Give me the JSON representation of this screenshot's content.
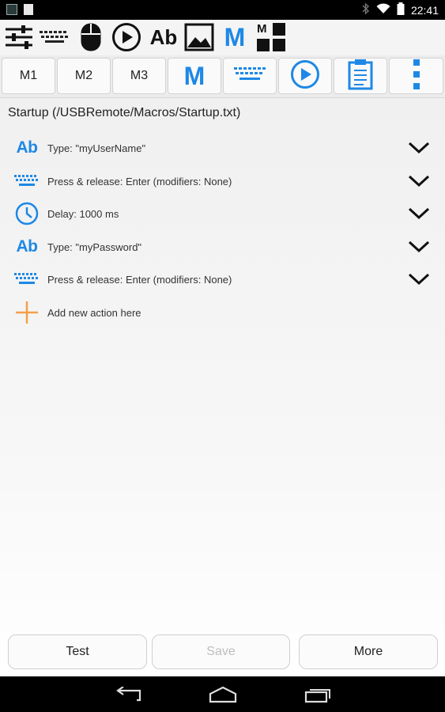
{
  "status_bar": {
    "time": "22:41",
    "icons": [
      "app-notification-icon",
      "sd-card-icon",
      "bluetooth-icon",
      "wifi-icon",
      "battery-icon"
    ]
  },
  "tool_strip": {
    "items": [
      "sliders-icon",
      "keyboard-icon",
      "mouse-icon",
      "play-icon",
      "text-ab-icon",
      "image-icon",
      "macro-m-icon",
      "macro-grid-icon"
    ],
    "ab_text": "Ab",
    "m_text": "M",
    "mini_m_text": "M"
  },
  "toolbar": {
    "m1": "M1",
    "m2": "M2",
    "m3": "M3",
    "m_text": "M",
    "icons": [
      "macro-m-icon",
      "keyboard-icon",
      "play-icon",
      "clipboard-icon",
      "overflow-menu-icon"
    ]
  },
  "macro": {
    "title": "Startup (/USBRemote/Macros/Startup.txt)",
    "actions": [
      {
        "icon": "text-ab-icon",
        "icon_text": "Ab",
        "label": "Type: \"myUserName\""
      },
      {
        "icon": "keyboard-icon",
        "label": "Press & release: Enter (modifiers: None)"
      },
      {
        "icon": "clock-icon",
        "label": "Delay: 1000 ms"
      },
      {
        "icon": "text-ab-icon",
        "icon_text": "Ab",
        "label": "Type: \"myPassword\""
      },
      {
        "icon": "keyboard-icon",
        "label": "Press & release: Enter (modifiers: None)"
      }
    ],
    "add_label": "Add new action here"
  },
  "bottom": {
    "test": "Test",
    "save": "Save",
    "more": "More"
  },
  "colors": {
    "accent": "#1e88e5",
    "add": "#f5a04a"
  }
}
